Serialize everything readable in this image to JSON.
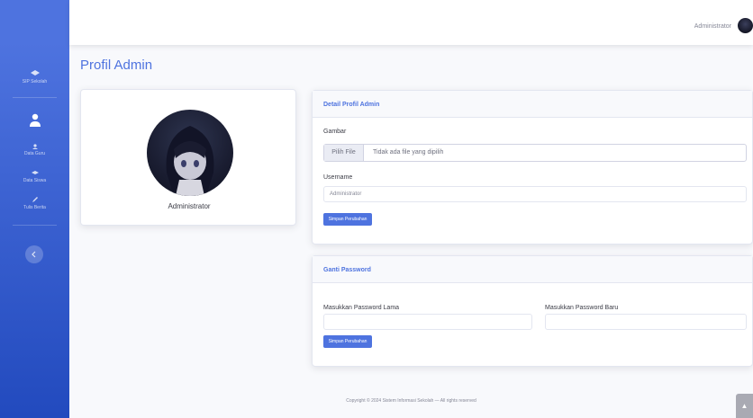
{
  "sidebar": {
    "brand_label": "SIP Sekolah",
    "items": [
      {
        "icon": "user-tie-icon",
        "label": ""
      },
      {
        "icon": "users-icon",
        "label": "Data Guru"
      },
      {
        "icon": "user-graduate-icon",
        "label": "Data Siswa"
      },
      {
        "icon": "pencil-icon",
        "label": "Tulis Berita"
      }
    ]
  },
  "topbar": {
    "user_name": "Administrator"
  },
  "page": {
    "title": "Profil Admin"
  },
  "profile_card": {
    "name": "Administrator"
  },
  "detail_card": {
    "title": "Detail Profil Admin",
    "gambar_label": "Gambar",
    "file_button": "Pilih File",
    "file_status": "Tidak ada file yang dipilih",
    "username_label": "Username",
    "username_value": "Administrator",
    "save_button": "Simpan Perubahan"
  },
  "password_card": {
    "title": "Ganti Password",
    "old_label": "Masukkan Password Lama",
    "new_label": "Masukkan Password Baru",
    "save_button": "Simpan Perubahan"
  },
  "footer": {
    "text": "Copyright © 2024 Sistem Informasi Sekolah — All rights reserved"
  },
  "colors": {
    "primary": "#4e73df",
    "sidebar_dark": "#224abe"
  }
}
